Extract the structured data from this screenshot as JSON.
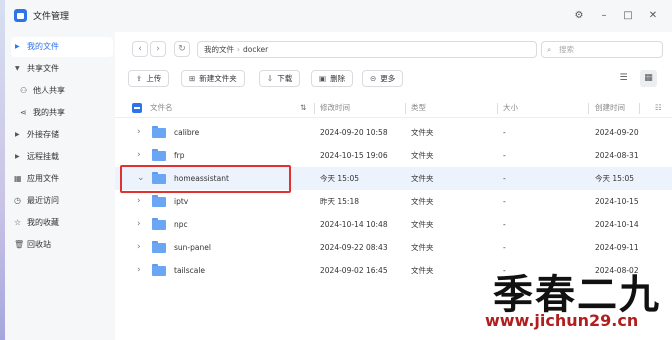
{
  "app": {
    "title": "文件管理",
    "icons": {
      "settings": "gear-icon",
      "minimize": "minimize-icon",
      "maximize": "maximize-icon",
      "close": "close-icon"
    }
  },
  "sidebar": {
    "items": [
      {
        "label": "我的文件",
        "icon": "caret-right",
        "active": true
      },
      {
        "label": "共享文件",
        "icon": "caret-down"
      },
      {
        "label": "他人共享",
        "icon": "users-icon"
      },
      {
        "label": "我的共享",
        "icon": "share-icon"
      },
      {
        "label": "外接存储",
        "icon": "caret-right"
      },
      {
        "label": "远程挂载",
        "icon": "caret-right"
      },
      {
        "label": "应用文件",
        "icon": "grid-icon"
      },
      {
        "label": "最近访问",
        "icon": "clock-icon"
      },
      {
        "label": "我的收藏",
        "icon": "star-icon"
      },
      {
        "label": "回收站",
        "icon": "trash-icon"
      }
    ]
  },
  "breadcrumb": {
    "root": "我的文件",
    "current": "docker"
  },
  "search": {
    "placeholder": "搜索"
  },
  "toolbar": {
    "upload": "上传",
    "new_folder": "新建文件夹",
    "download": "下载",
    "delete": "删除",
    "more": "更多"
  },
  "table": {
    "headers": {
      "name": "文件名",
      "modified": "修改时间",
      "type": "类型",
      "size": "大小",
      "created": "创建时间"
    },
    "rows": [
      {
        "name": "calibre",
        "modified": "2024-09-20 10:58",
        "type": "文件夹",
        "size": "-",
        "created": "2024-09-20"
      },
      {
        "name": "frp",
        "modified": "2024-10-15 19:06",
        "type": "文件夹",
        "size": "-",
        "created": "2024-08-31"
      },
      {
        "name": "homeassistant",
        "modified": "今天 15:05",
        "type": "文件夹",
        "size": "-",
        "created": "今天 15:05",
        "selected": true,
        "expanded": true
      },
      {
        "name": "iptv",
        "modified": "昨天 15:18",
        "type": "文件夹",
        "size": "-",
        "created": "2024-10-15"
      },
      {
        "name": "npc",
        "modified": "2024-10-14 10:48",
        "type": "文件夹",
        "size": "-",
        "created": "2024-10-14"
      },
      {
        "name": "sun-panel",
        "modified": "2024-09-22 08:43",
        "type": "文件夹",
        "size": "-",
        "created": "2024-09-11"
      },
      {
        "name": "tailscale",
        "modified": "2024-09-02 16:45",
        "type": "文件夹",
        "size": "-",
        "created": "2024-08-02"
      }
    ]
  },
  "watermark": {
    "text": "季春二九",
    "url": "www.jichun29.cn"
  },
  "colors": {
    "accent": "#2f73ea",
    "highlight_border": "#e0322e",
    "selected_row": "#edf3fd",
    "folder": "#6aa6f4"
  }
}
